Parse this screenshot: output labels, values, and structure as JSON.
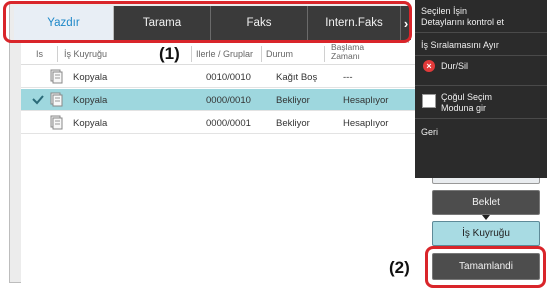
{
  "tabs": [
    {
      "label": "Yazdır",
      "active": true
    },
    {
      "label": "Tarama",
      "active": false
    },
    {
      "label": "Faks",
      "active": false
    },
    {
      "label": "Intern.Faks",
      "active": false
    }
  ],
  "tab_arrow": "›",
  "table": {
    "headers": {
      "col1": "Is",
      "col2": "İş Kuyruğu",
      "col3": "Ilerle / Gruplar",
      "col4": "Durum",
      "col5_line1": "Başlama",
      "col5_line2": "Zamanı"
    },
    "rows": [
      {
        "queue": "Kopyala",
        "progress": "0010/0010",
        "status": "Kağıt Boş",
        "start": "---",
        "selected": false
      },
      {
        "queue": "Kopyala",
        "progress": "0000/0010",
        "status": "Bekliyor",
        "start": "Hesaplıyor",
        "selected": true
      },
      {
        "queue": "Kopyala",
        "progress": "0000/0001",
        "status": "Bekliyor",
        "start": "Hesaplıyor",
        "selected": false
      }
    ]
  },
  "callouts": {
    "one": "(1)",
    "two": "(2)"
  },
  "menu": {
    "item1_line1": "Seçilen İşin",
    "item1_line2": "Detaylarını kontrol et",
    "item2": "İş Sıralamasını Ayır",
    "item3": "Dur/Sil",
    "item4_line1": "Çoğul Seçim",
    "item4_line2": "Moduna gir",
    "item5": "Geri"
  },
  "buttons": {
    "hold": "Beklet",
    "job_queue": "İş Kuyruğu",
    "completed": "Tamamlandi"
  },
  "colors": {
    "accent_tab_text": "#1e88c8",
    "selected_row": "#9ed7de",
    "highlight_red": "#d9252a",
    "menu_bg": "#2b2b2b"
  }
}
